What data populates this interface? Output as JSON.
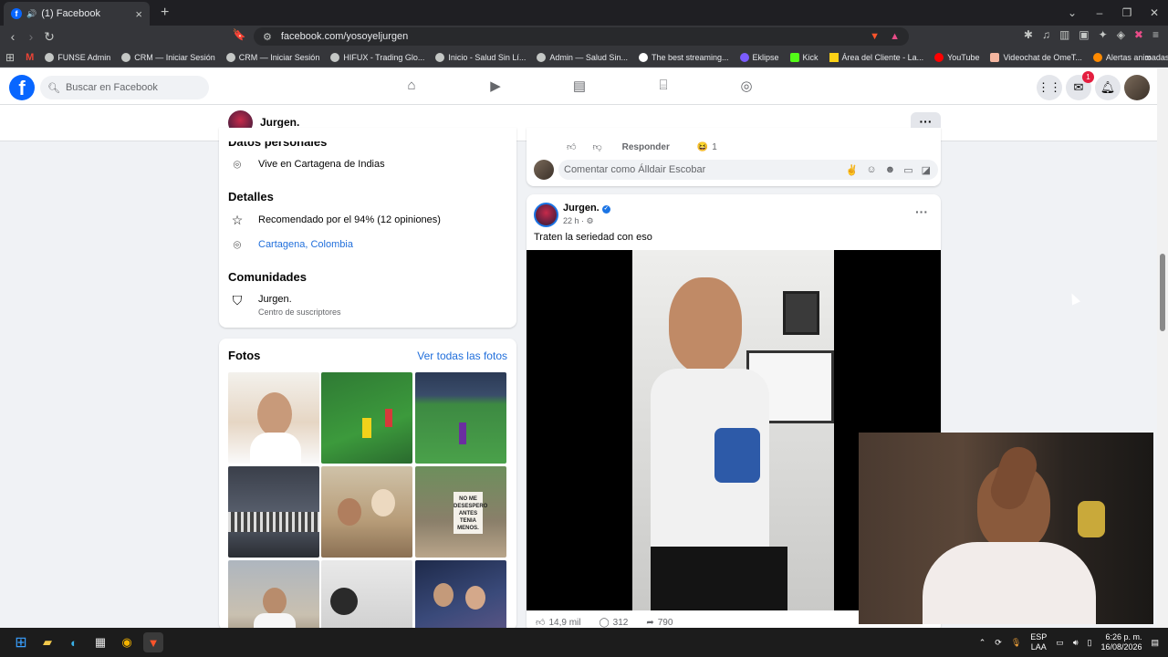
{
  "browser": {
    "tab_title": "(1) Facebook",
    "new_tab": "+",
    "url": "facebook.com/yosoyeljurgen",
    "bookmarks": [
      "FUNSE Admin",
      "CRM — Iniciar Sesión",
      "CRM — Iniciar Sesión",
      "HIFUX - Trading Glo...",
      "Inicio - Salud Sin Lí...",
      "Admin — Salud Sin...",
      "The best streaming...",
      "Eklipse",
      "Kick",
      "Área del Cliente - La...",
      "YouTube",
      "Videochat de OmeT...",
      "Alertas animadas de..."
    ],
    "bookmarks_more": "»"
  },
  "fb_header": {
    "search_placeholder": "Buscar en Facebook",
    "messenger_badge": "1"
  },
  "profile": {
    "name": "Jurgen.",
    "more": "···"
  },
  "about": {
    "personal_title": "Datos personales",
    "lives_in": "Vive en Cartagena de Indias",
    "details_title": "Detalles",
    "recommended": "Recomendado por el 94% (12 opiniones)",
    "location": "Cartagena, Colombia",
    "communities_title": "Comunidades",
    "community_name": "Jurgen.",
    "community_sub": "Centro de suscriptores"
  },
  "photos": {
    "title": "Fotos",
    "see_all": "Ver todas las fotos",
    "sign_text": "NO ME DESESPERO ANTES TENIA MENOS."
  },
  "prev_post": {
    "reply": "Responder",
    "reaction_count": "1",
    "comment_placeholder": "Comentar como Álldair Escobar"
  },
  "post": {
    "author": "Jurgen.",
    "time": "22 h ·",
    "text": "Traten la seriedad con eso",
    "more": "···",
    "likes": "14,9 mil",
    "comments": "312",
    "shares": "790"
  },
  "taskbar": {
    "lang": "ESP",
    "lang2": "LAA",
    "time": "6:26 p. m.",
    "date": "16/08/2026"
  }
}
